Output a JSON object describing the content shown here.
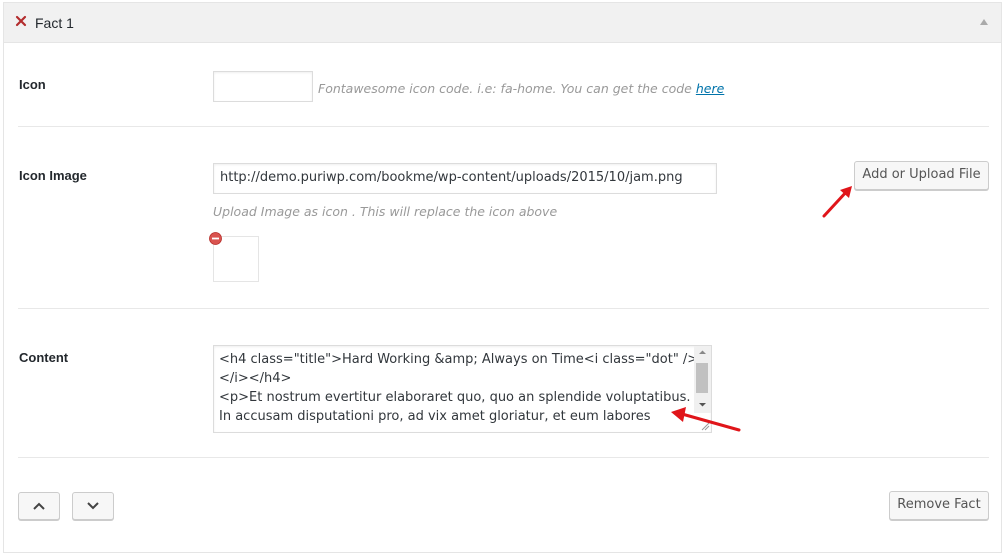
{
  "header": {
    "title": "Fact 1"
  },
  "fields": {
    "icon": {
      "label": "Icon",
      "value": "",
      "description": "Fontawesome icon code. i.e: fa-home. You can get the code ",
      "link_text": "here"
    },
    "icon_image": {
      "label": "Icon Image",
      "value": "http://demo.puriwp.com/bookme/wp-content/uploads/2015/10/jam.png",
      "description": "Upload Image as icon . This will replace the icon above",
      "upload_button": "Add or Upload File"
    },
    "content": {
      "label": "Content",
      "lines": [
        "<h4 class=\"title\">Hard Working &amp; Always on Time<i class=\"dot\" />",
        "</i></h4>",
        "<p>Et nostrum evertitur elaboraret quo, quo an splendide voluptatibus.",
        "In accusam disputationi pro, ad vix amet gloriatur, et eum labores"
      ]
    }
  },
  "footer": {
    "remove_button": "Remove Fact"
  },
  "colors": {
    "remove_icon": "#b32d2e",
    "annotation_arrow": "#e0151a",
    "link": "#0073aa"
  },
  "icons": [
    "remove-x-icon",
    "toggle-up-icon",
    "remove-circle-icon",
    "chevron-up-icon",
    "chevron-down-icon"
  ]
}
